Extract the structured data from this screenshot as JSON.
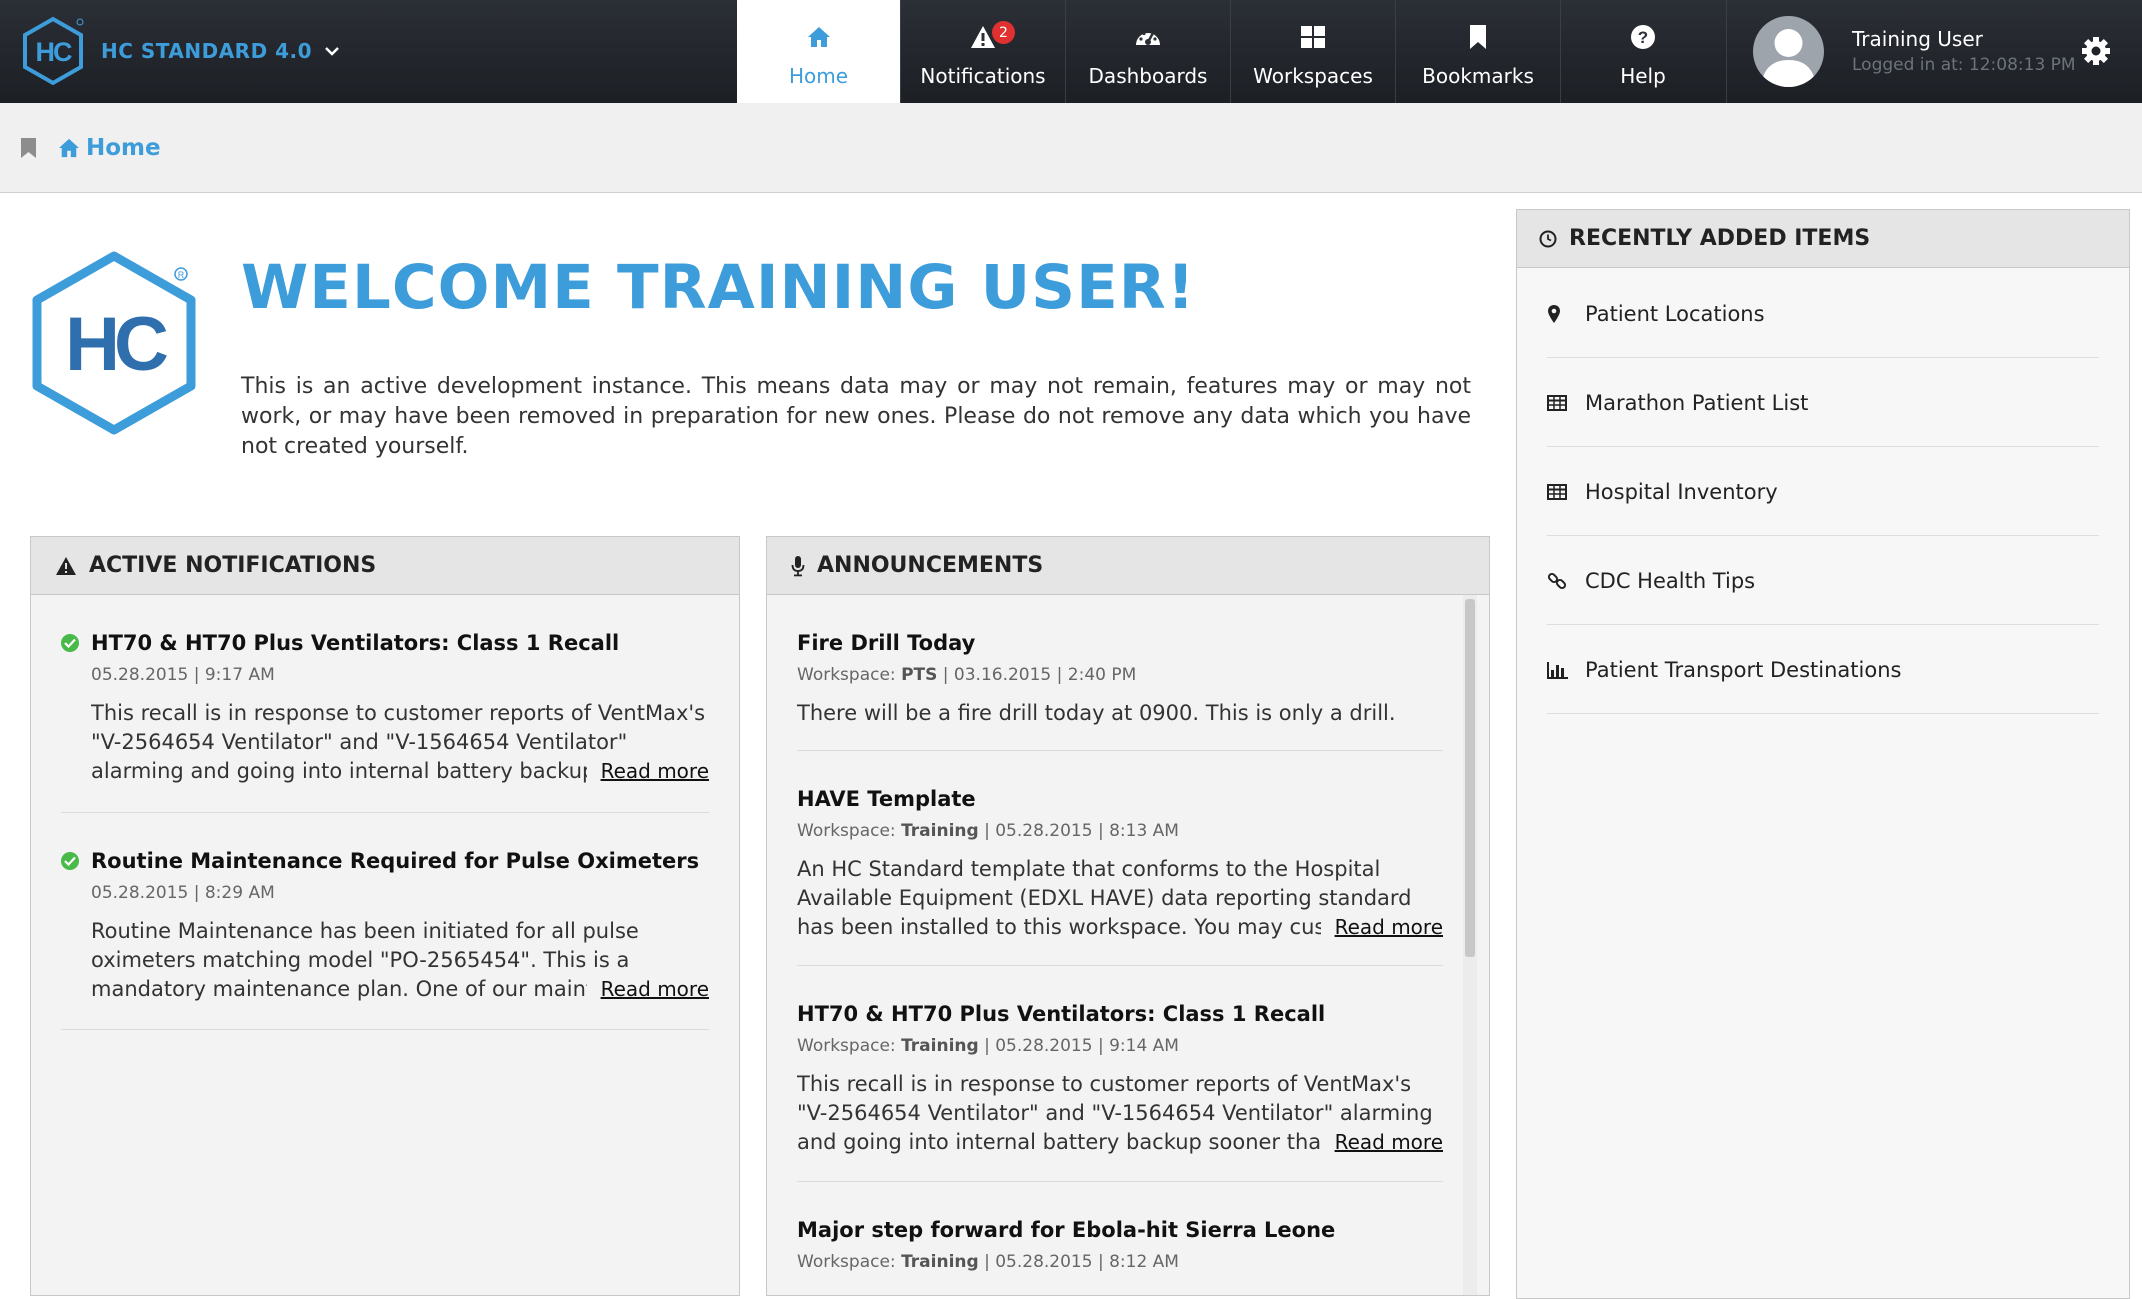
{
  "app": {
    "title": "HC STANDARD 4.0",
    "accent_color": "#3d9ddb"
  },
  "nav": {
    "items": [
      {
        "label": "Home",
        "icon": "home-icon",
        "active": true
      },
      {
        "label": "Notifications",
        "icon": "alert-icon",
        "badge": "2"
      },
      {
        "label": "Dashboards",
        "icon": "dashboard-icon"
      },
      {
        "label": "Workspaces",
        "icon": "grid-icon"
      },
      {
        "label": "Bookmarks",
        "icon": "bookmark-icon"
      },
      {
        "label": "Help",
        "icon": "help-icon"
      }
    ]
  },
  "user": {
    "name": "Training User",
    "login_text": "Logged in at: 12:08:13 PM"
  },
  "breadcrumb": {
    "home": "Home"
  },
  "welcome": {
    "title": "WELCOME TRAINING USER!",
    "text": "This is an active development instance. This means data may or may not remain, features may or may not work, or may have been removed in preparation for new ones. Please do not remove any data which you have not created yourself."
  },
  "active_notifications": {
    "title": "ACTIVE NOTIFICATIONS",
    "items": [
      {
        "title": "HT70 & HT70 Plus Ventilators: Class 1 Recall",
        "meta": "05.28.2015 | 9:17 AM",
        "body": "This recall is in response to customer reports of VentMax's \"V-2564654 Ventilator\" and \"V-1564654 Ventilator\" alarming and going into internal battery backup sooner than ex",
        "read_more": "Read more"
      },
      {
        "title": "Routine Maintenance Required for Pulse Oximeters",
        "meta": "05.28.2015 | 8:29 AM",
        "body": "Routine Maintenance has been initiated for all pulse oximeters matching model \"PO-2565454\". This is a mandatory maintenance plan. One of our maintenance techn",
        "read_more": "Read more"
      }
    ]
  },
  "announcements": {
    "title": "ANNOUNCEMENTS",
    "workspace_label": "Workspace:",
    "items": [
      {
        "title": "Fire Drill Today",
        "workspace": "PTS",
        "date": "| 03.16.2015 | 2:40 PM",
        "body": "There will be a fire drill today at 0900. This is only a drill."
      },
      {
        "title": "HAVE Template",
        "workspace": "Training",
        "date": "| 05.28.2015 | 8:13 AM",
        "body": "An HC Standard template that conforms to the Hospital Available Equipment (EDXL HAVE) data reporting standard has been installed to this workspace. You may customize and e",
        "read_more": "Read more"
      },
      {
        "title": "HT70 & HT70 Plus Ventilators: Class 1 Recall",
        "workspace": "Training",
        "date": "| 05.28.2015 | 9:14 AM",
        "body": "This recall is in response to customer reports of VentMax's \"V-2564654 Ventilator\" and \"V-1564654 Ventilator\" alarming and going into internal battery backup sooner than expec",
        "read_more": "Read more"
      },
      {
        "title": "Major step forward for Ebola-hit Sierra Leone",
        "workspace": "Training",
        "date": "| 05.28.2015 | 8:12 AM"
      }
    ]
  },
  "recent": {
    "title": "RECENTLY ADDED ITEMS",
    "items": [
      {
        "label": "Patient Locations",
        "icon": "map-pin-icon"
      },
      {
        "label": "Marathon Patient List",
        "icon": "table-icon"
      },
      {
        "label": "Hospital Inventory",
        "icon": "table-icon"
      },
      {
        "label": "CDC Health Tips",
        "icon": "link-icon"
      },
      {
        "label": "Patient Transport Destinations",
        "icon": "bar-chart-icon"
      }
    ]
  }
}
